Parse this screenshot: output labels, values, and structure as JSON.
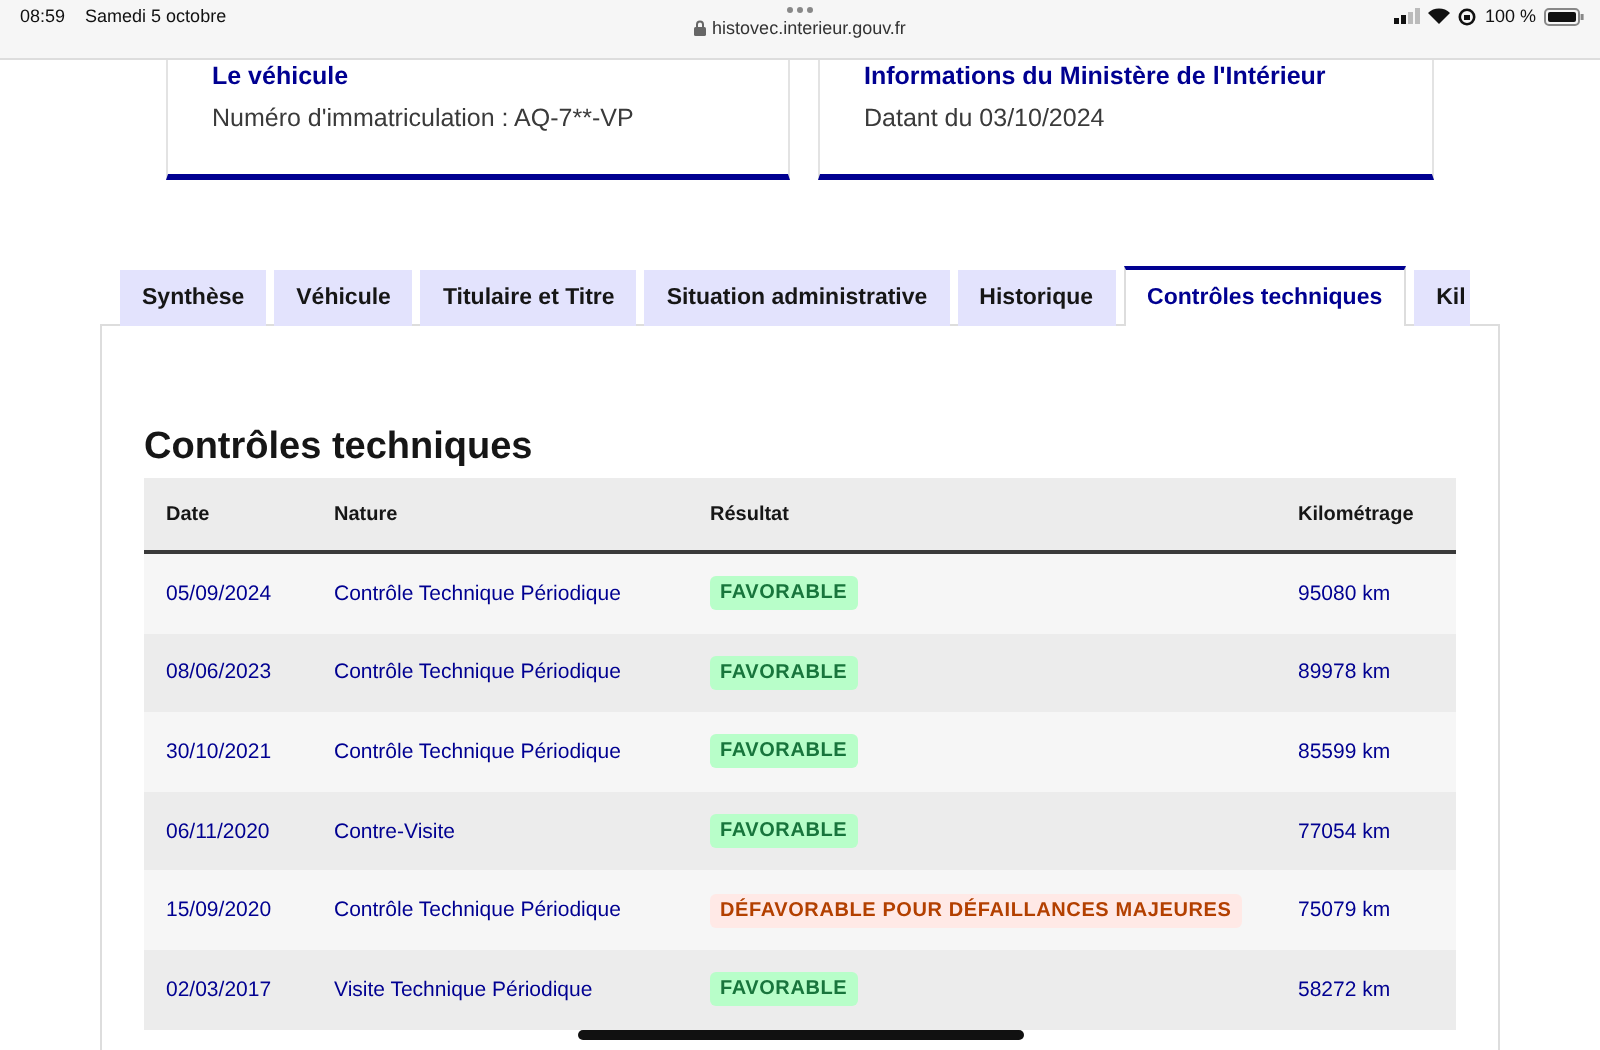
{
  "status_bar": {
    "time": "08:59",
    "date": "Samedi 5 octobre",
    "url": "histovec.interieur.gouv.fr",
    "battery": "100 %"
  },
  "cards": [
    {
      "title": "Le véhicule",
      "text": "Numéro d'immatriculation : AQ-7**-VP"
    },
    {
      "title": "Informations du Ministère de l'Intérieur",
      "text": "Datant du 03/10/2024"
    }
  ],
  "tabs": [
    {
      "label": "Synthèse",
      "selected": false
    },
    {
      "label": "Véhicule",
      "selected": false
    },
    {
      "label": "Titulaire et Titre",
      "selected": false
    },
    {
      "label": "Situation administrative",
      "selected": false
    },
    {
      "label": "Historique",
      "selected": false
    },
    {
      "label": "Contrôles techniques",
      "selected": true
    },
    {
      "label": "Kil",
      "selected": false
    }
  ],
  "section_title": "Contrôles techniques",
  "table": {
    "columns": [
      "Date",
      "Nature",
      "Résultat",
      "Kilométrage"
    ],
    "rows": [
      {
        "date": "05/09/2024",
        "nature": "Contrôle Technique Périodique",
        "result": {
          "kind": "favorable",
          "label": "FAVORABLE"
        },
        "km": "95080 km"
      },
      {
        "date": "08/06/2023",
        "nature": "Contrôle Technique Périodique",
        "result": {
          "kind": "favorable",
          "label": "FAVORABLE"
        },
        "km": "89978 km"
      },
      {
        "date": "30/10/2021",
        "nature": "Contrôle Technique Périodique",
        "result": {
          "kind": "favorable",
          "label": "FAVORABLE"
        },
        "km": "85599 km"
      },
      {
        "date": "06/11/2020",
        "nature": "Contre-Visite",
        "result": {
          "kind": "favorable",
          "label": "FAVORABLE"
        },
        "km": "77054 km"
      },
      {
        "date": "15/09/2020",
        "nature": "Contrôle Technique Périodique",
        "result": {
          "kind": "defavorable",
          "label": "DÉFAVORABLE POUR DÉFAILLANCES MAJEURES"
        },
        "km": "75079 km"
      },
      {
        "date": "02/03/2017",
        "nature": "Visite Technique Périodique",
        "result": {
          "kind": "favorable",
          "label": "FAVORABLE"
        },
        "km": "58272 km"
      }
    ]
  }
}
